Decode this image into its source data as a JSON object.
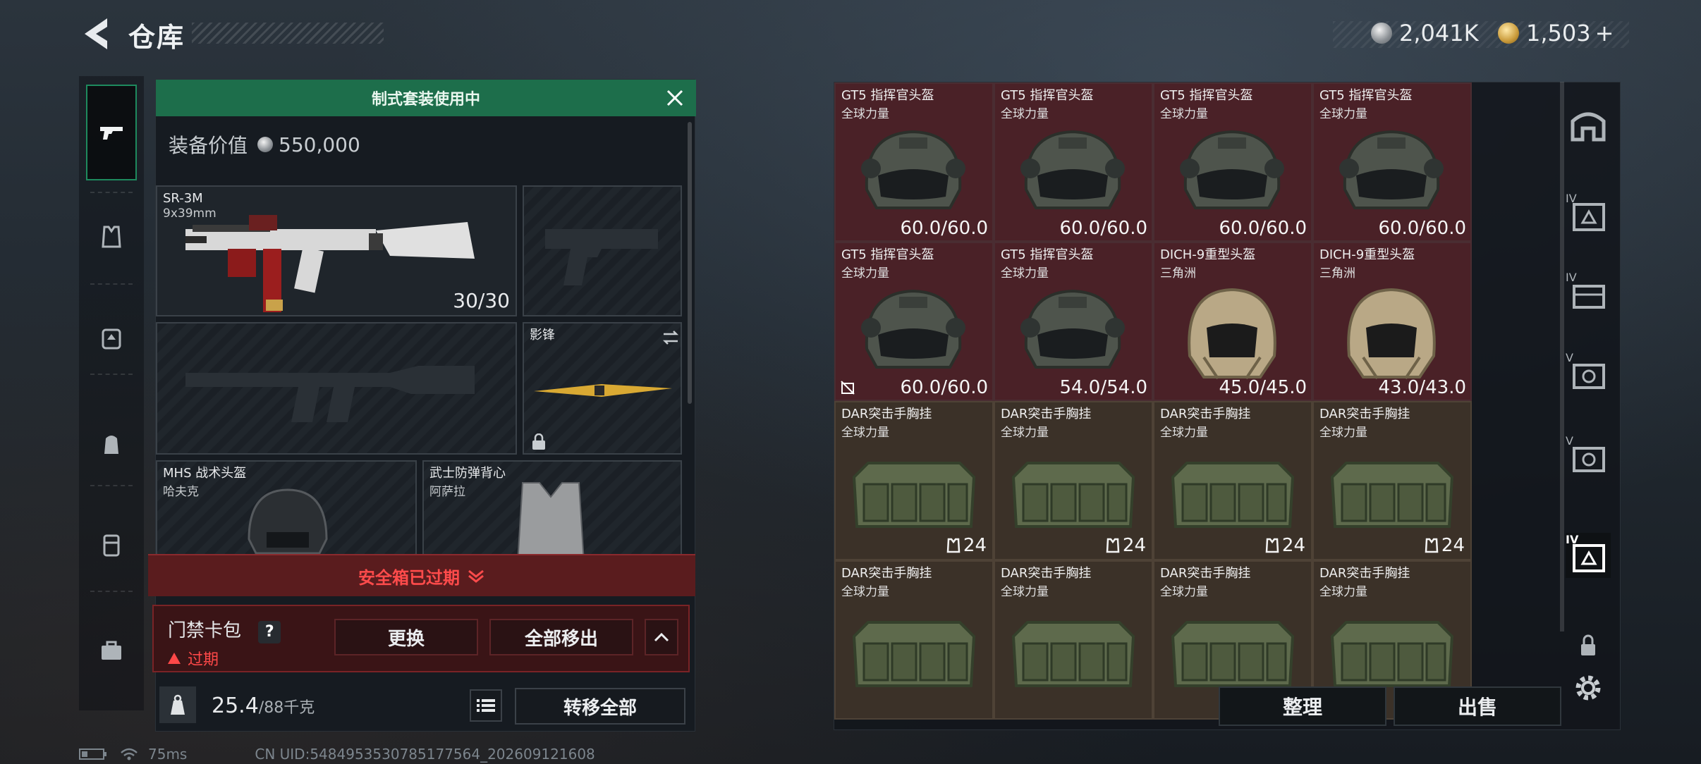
{
  "header": {
    "title": "仓库"
  },
  "currency": {
    "silver": "2,041K",
    "gold": "1,503",
    "gold_plus": "+"
  },
  "loadout": {
    "banner": "制式套装使用中",
    "value_label": "装备价值",
    "value": "550,000",
    "primary": {
      "name": "SR-3M",
      "caliber": "9x39mm",
      "ammo": "30/30"
    },
    "melee": {
      "name": "影锋"
    },
    "helmet": {
      "name": "MHS 战术头盔",
      "sub": "哈夫克"
    },
    "armor": {
      "name": "武士防弹背心",
      "sub": "阿萨拉"
    },
    "safebox_expired": "安全箱已过期",
    "card_label": "门禁卡包",
    "help": "?",
    "card_status": "过期",
    "replace_btn": "更换",
    "remove_all_btn": "全部移出",
    "weight": "25.4",
    "weight_max": "/88千克",
    "transfer_all_btn": "转移全部"
  },
  "storage": {
    "items": [
      {
        "name": "GT5 指挥官头盔",
        "sub": "全球力量",
        "value": "60.0/60.0",
        "kind": "helmet-black"
      },
      {
        "name": "GT5 指挥官头盔",
        "sub": "全球力量",
        "value": "60.0/60.0",
        "kind": "helmet-black"
      },
      {
        "name": "GT5 指挥官头盔",
        "sub": "全球力量",
        "value": "60.0/60.0",
        "kind": "helmet-black"
      },
      {
        "name": "GT5 指挥官头盔",
        "sub": "全球力量",
        "value": "60.0/60.0",
        "kind": "helmet-black"
      },
      {
        "name": "GT5 指挥官头盔",
        "sub": "全球力量",
        "value": "60.0/60.0",
        "kind": "helmet-black"
      },
      {
        "name": "GT5 指挥官头盔",
        "sub": "全球力量",
        "value": "54.0/54.0",
        "kind": "helmet-black"
      },
      {
        "name": "DICH-9重型头盔",
        "sub": "三角洲",
        "value": "45.0/45.0",
        "kind": "helmet-tan"
      },
      {
        "name": "DICH-9重型头盔",
        "sub": "三角洲",
        "value": "43.0/43.0",
        "kind": "helmet-tan"
      },
      {
        "name": "DAR突击手胸挂",
        "sub": "全球力量",
        "value": "24",
        "kind": "rig"
      },
      {
        "name": "DAR突击手胸挂",
        "sub": "全球力量",
        "value": "24",
        "kind": "rig"
      },
      {
        "name": "DAR突击手胸挂",
        "sub": "全球力量",
        "value": "24",
        "kind": "rig"
      },
      {
        "name": "DAR突击手胸挂",
        "sub": "全球力量",
        "value": "24",
        "kind": "rig"
      },
      {
        "name": "DAR突击手胸挂",
        "sub": "全球力量",
        "value": "",
        "kind": "rig"
      },
      {
        "name": "DAR突击手胸挂",
        "sub": "全球力量",
        "value": "",
        "kind": "rig"
      },
      {
        "name": "DAR突击手胸挂",
        "sub": "全球力量",
        "value": "",
        "kind": "rig"
      },
      {
        "name": "DAR突击手胸挂",
        "sub": "全球力量",
        "value": "",
        "kind": "rig"
      }
    ],
    "sort_btn": "整理",
    "sell_btn": "出售"
  },
  "rightnav_labels": [
    "IV",
    "IV",
    "V",
    "V",
    "IV"
  ],
  "status": {
    "ping": "75ms",
    "uid": "CN UID:5484953530785177564_202609121608"
  },
  "colors": {
    "accent_green": "#1d6e4b",
    "warning_red": "#ff4b4b",
    "cell_red": "#4a2127",
    "cell_brown": "#3b3128"
  }
}
